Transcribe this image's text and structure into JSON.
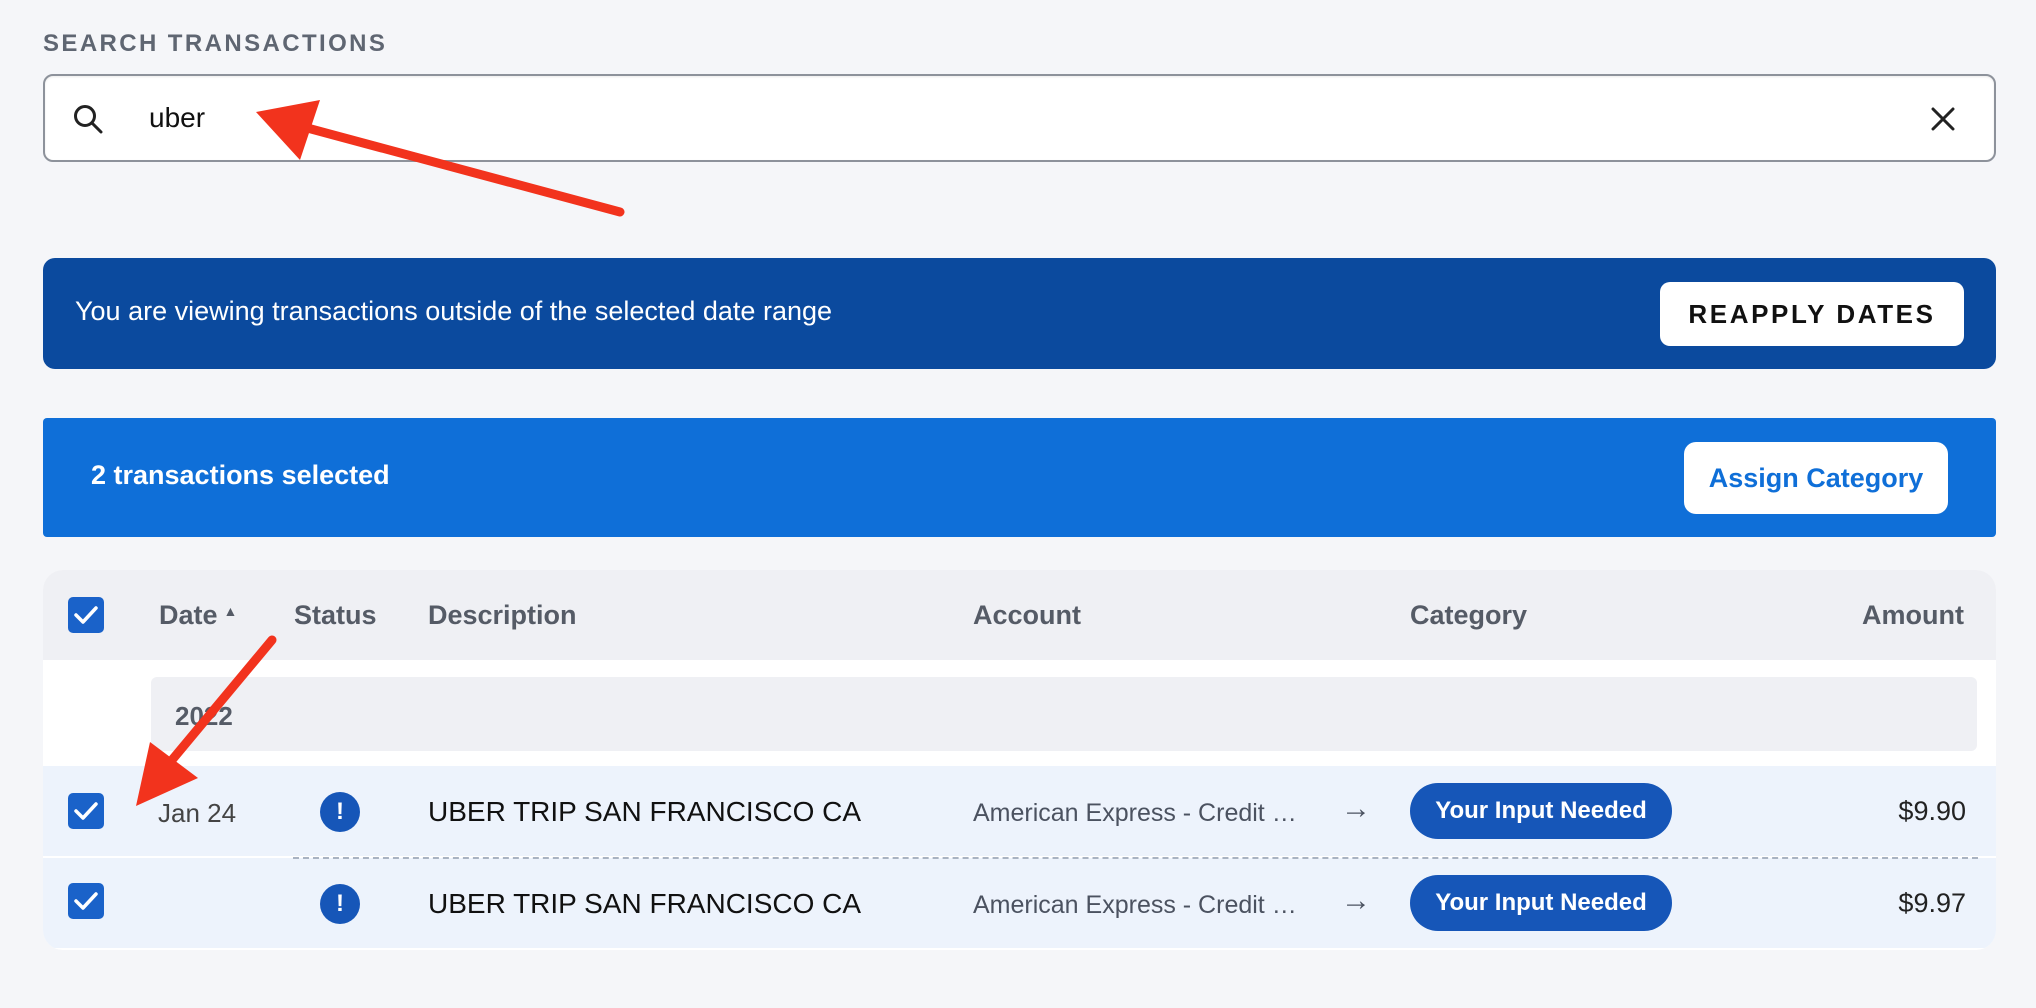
{
  "search": {
    "label": "SEARCH TRANSACTIONS",
    "value": "uber",
    "search_icon": "search-icon",
    "clear_icon": "close-icon"
  },
  "date_banner": {
    "message": "You are viewing transactions outside of the selected date range",
    "button_label": "REAPPLY DATES"
  },
  "selection_bar": {
    "message": "2 transactions selected",
    "button_label": "Assign Category"
  },
  "table": {
    "headers": {
      "date": "Date",
      "status": "Status",
      "description": "Description",
      "account": "Account",
      "category": "Category",
      "amount": "Amount"
    },
    "sort_indicator": "▲",
    "year": "2022",
    "rows": [
      {
        "date": "Jan 24",
        "status_icon": "!",
        "description": "UBER TRIP SAN FRANCISCO CA",
        "account": "American Express - Credit Card",
        "arrow": "→",
        "category": "Your Input Needed",
        "amount": "$9.90",
        "selected": true
      },
      {
        "date": "",
        "status_icon": "!",
        "description": "UBER TRIP SAN FRANCISCO CA",
        "account": "American Express - Credit Card",
        "arrow": "→",
        "category": "Your Input Needed",
        "amount": "$9.97",
        "selected": true
      }
    ]
  },
  "colors": {
    "banner_dark": "#0b4a9e",
    "banner_bright": "#0f6fd8",
    "pill": "#1656b8",
    "annotation_arrow": "#f2331d"
  }
}
